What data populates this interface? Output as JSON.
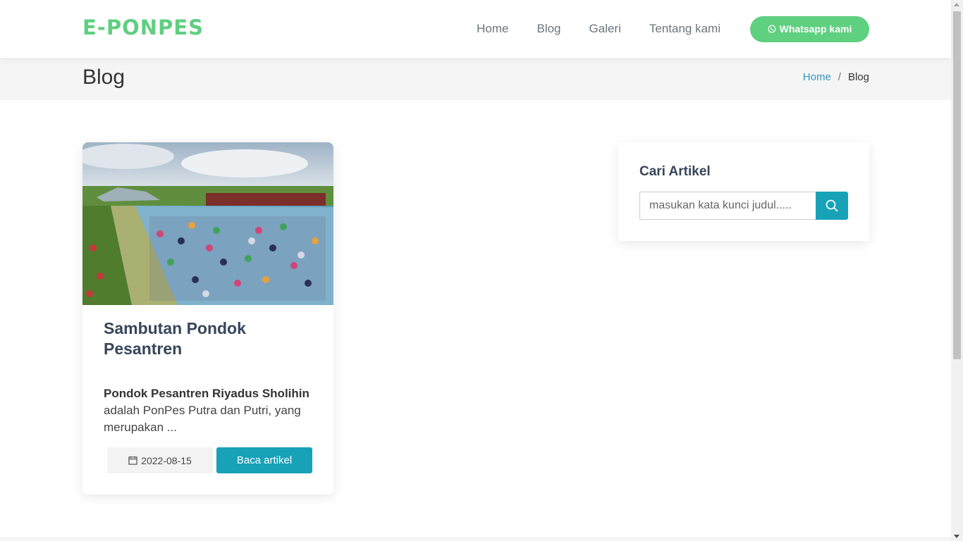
{
  "header": {
    "logo": "E-PONPES",
    "nav": [
      {
        "label": "Home"
      },
      {
        "label": "Blog"
      },
      {
        "label": "Galeri"
      },
      {
        "label": "Tentang kami"
      }
    ],
    "whatsapp_label": "Whatsapp kami"
  },
  "band": {
    "title": "Blog",
    "breadcrumb_home": "Home",
    "breadcrumb_separator": "/",
    "breadcrumb_current": "Blog"
  },
  "article": {
    "title": "Sambutan Pondok Pesantren",
    "excerpt_bold": "Pondok Pesantren Riyadus Sholihin",
    "excerpt_rest": "adalah PonPes Putra dan Putri, yang merupakan ...",
    "date": "2022-08-15",
    "read_label": "Baca artikel"
  },
  "sidebar": {
    "title": "Cari Artikel",
    "search_placeholder": "masukan kata kunci judul....."
  },
  "colors": {
    "brand_green": "#5fcf80",
    "accent_teal": "#17a2b8",
    "link_blue": "#2d97c4",
    "heading": "#37465a"
  },
  "icons": [
    "whatsapp-icon",
    "calendar-icon",
    "search-icon"
  ]
}
